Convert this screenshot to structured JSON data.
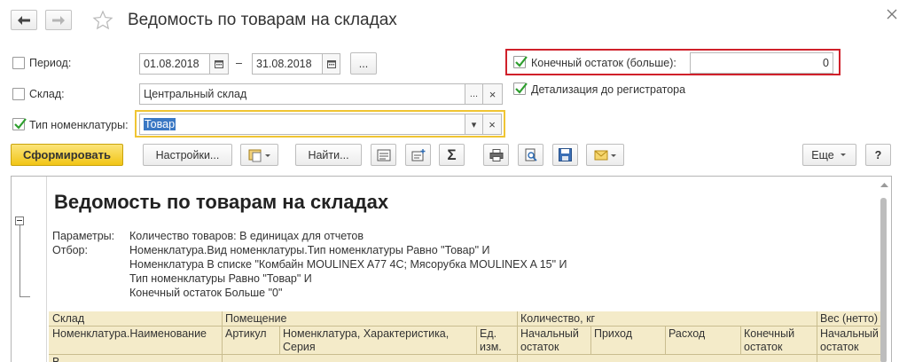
{
  "window": {
    "title": "Ведомость по товарам на складах"
  },
  "filters": {
    "period_label": "Период:",
    "date_from": "01.08.2018",
    "date_separator": "–",
    "date_to": "31.08.2018",
    "ellipsis_label": "...",
    "warehouse_label": "Склад:",
    "warehouse_value": "Центральный склад",
    "nomenclature_type_label": "Тип номенклатуры:",
    "nomenclature_type_value": "Товар",
    "final_balance_label": "Конечный остаток (больше):",
    "final_balance_value": "0",
    "register_detail_label": "Детализация до регистратора",
    "clear_label": "×",
    "dropdown_label": "▾"
  },
  "toolbar": {
    "generate_label": "Сформировать",
    "settings_label": "Настройки...",
    "find_label": "Найти...",
    "sum_label": "Σ",
    "more_label": "Еще",
    "help_label": "?"
  },
  "report": {
    "title": "Ведомость по товарам на складах",
    "params_label": "Параметры:",
    "params_value": "Количество товаров: В единицах для отчетов",
    "filter_label": "Отбор:",
    "filter_lines": [
      "Номенклатура.Вид номенклатуры.Тип номенклатуры Равно \"Товар\" И",
      "Номенклатура В списке \"Комбайн MOULINEX  A77 4C; Мясорубка MOULINEX  A 15\" И",
      "Тип номенклатуры Равно \"Товар\" И",
      "Конечный остаток Больше \"0\""
    ],
    "table": {
      "row1": [
        "Склад",
        "Помещение",
        "Количество, кг",
        "Вес (нетто)"
      ],
      "row2": [
        "Номенклатура.Наименование",
        "Артикул",
        "Номенклатура, Характеристика,",
        "Ед.",
        "Начальный",
        "Приход",
        "Расход",
        "Конечный",
        "Начальный"
      ],
      "row3": [
        "Серия",
        "изм.",
        "остаток",
        "остаток",
        "остаток"
      ],
      "row4_partial": "В"
    }
  },
  "colors": {
    "primary_button": "#f2c516",
    "highlight_border": "#d0202a",
    "active_field_border": "#f0c533",
    "check": "#2e9e2e",
    "table_header": "#f4ebc9"
  }
}
